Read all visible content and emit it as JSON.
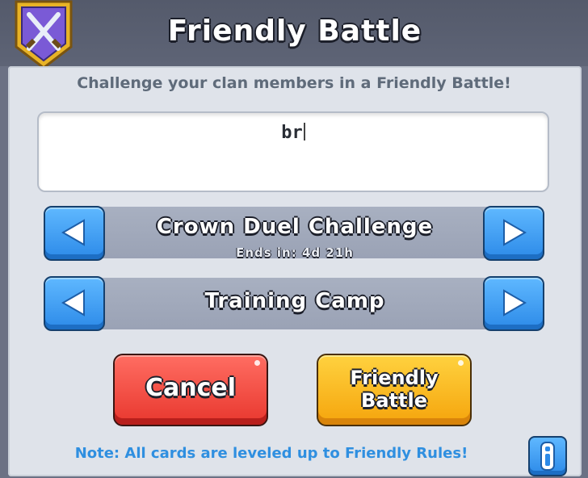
{
  "dialog": {
    "title": "Friendly Battle",
    "subtitle": "Challenge your clan members in a Friendly Battle!"
  },
  "input": {
    "value": "br"
  },
  "selectors": [
    {
      "label": "Crown Duel Challenge",
      "sublabel": "Ends in: 4d 21h"
    },
    {
      "label": "Training Camp"
    }
  ],
  "buttons": {
    "cancel": "Cancel",
    "friendly_battle_line1": "Friendly",
    "friendly_battle_line2": "Battle",
    "info": "i"
  },
  "note": "Note: All cards are leveled up to Friendly Rules!",
  "icons": {
    "emblem": "crossed-swords-emblem-icon",
    "left_arrow": "left-arrow-icon",
    "right_arrow": "right-arrow-icon",
    "info": "info-icon"
  },
  "colors": {
    "accent_blue": "#2c8ae8",
    "cancel_red": "#e8372e",
    "battle_yellow": "#f5a40c",
    "note_blue": "#2f8fe0"
  }
}
